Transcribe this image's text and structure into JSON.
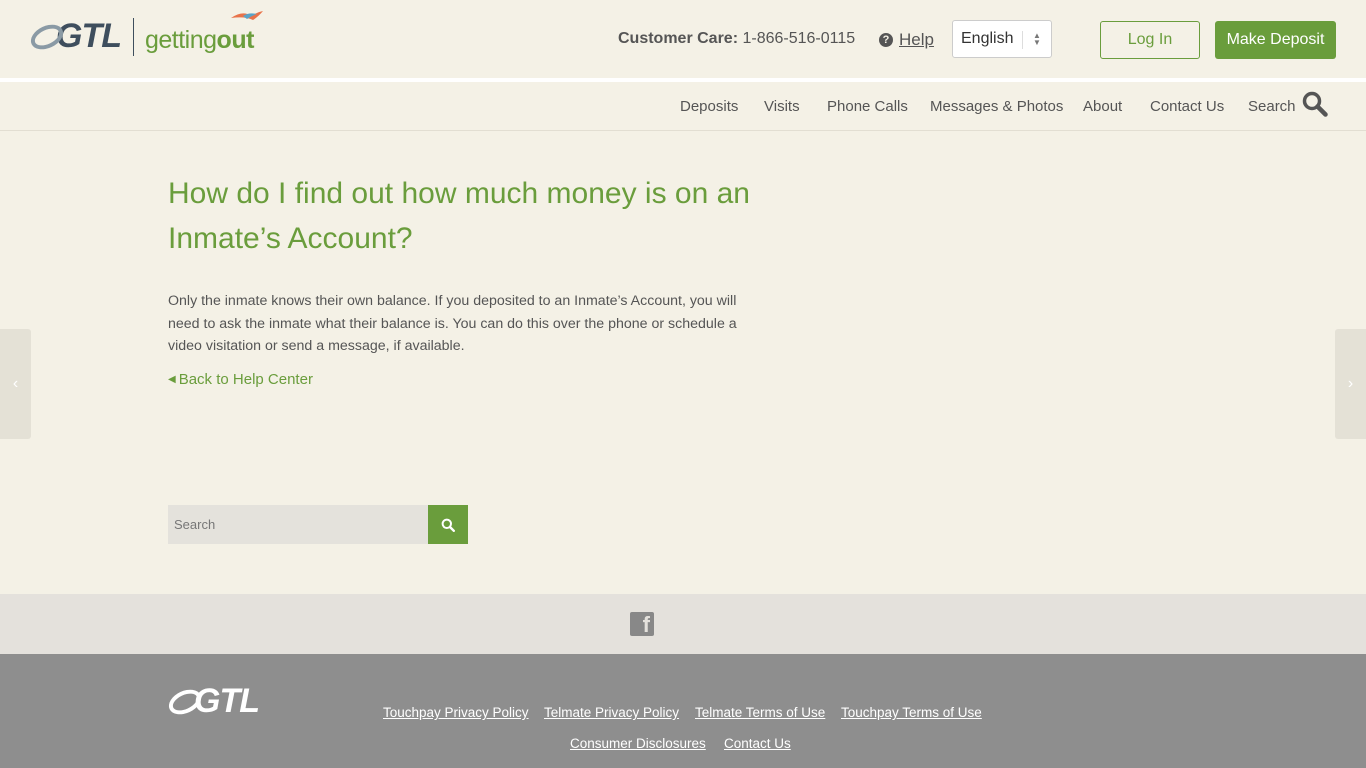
{
  "header": {
    "logo_gtl": "GTL",
    "logo_product_prefix": "getting",
    "logo_product_suffix": "out",
    "customer_care_label": "Customer Care:",
    "customer_care_phone": "1-866-516-0115",
    "help_label": "Help",
    "language_selected": "English",
    "login_label": "Log In",
    "deposit_label": "Make Deposit"
  },
  "nav": {
    "items": [
      "Deposits",
      "Visits",
      "Phone Calls",
      "Messages & Photos",
      "About",
      "Contact Us",
      "Search"
    ]
  },
  "main": {
    "title": "How do I find out how much money is on an Inmate’s Account?",
    "body": "Only the inmate knows their own balance. If you deposited to an Inmate’s Account, you will need to ask the inmate what their balance is. You can do this over the phone or schedule a video visitation or send a message, if available.",
    "back_link": "Back to Help Center",
    "search_placeholder": "Search"
  },
  "footer": {
    "logo": "GTL",
    "links_row1": [
      "Touchpay Privacy Policy",
      "Telmate Privacy Policy",
      "Telmate Terms of Use",
      "Touchpay Terms of Use"
    ],
    "links_row2": [
      "Consumer Disclosures",
      "Contact Us"
    ]
  },
  "colors": {
    "brand_green": "#6a9d3c",
    "background": "#f4f1e6",
    "footer": "#8e8e8e"
  },
  "icons": [
    "help-circle-icon",
    "select-arrows-icon",
    "search-icon",
    "chevron-left-icon",
    "chevron-right-icon",
    "caret-left-icon",
    "facebook-icon"
  ]
}
